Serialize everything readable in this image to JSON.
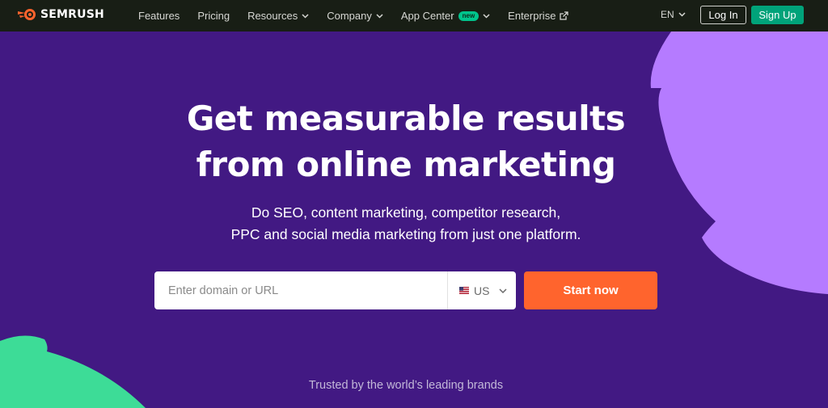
{
  "brand": {
    "name": "SEMRUSH",
    "logo_icon": "semrush-fire-icon"
  },
  "nav": {
    "items": [
      {
        "label": "Features",
        "dropdown": false
      },
      {
        "label": "Pricing",
        "dropdown": false
      },
      {
        "label": "Resources",
        "dropdown": true
      },
      {
        "label": "Company",
        "dropdown": true
      },
      {
        "label": "App Center",
        "dropdown": true,
        "badge": "new"
      },
      {
        "label": "Enterprise",
        "external": true
      }
    ],
    "language": "EN",
    "login_label": "Log In",
    "signup_label": "Sign Up"
  },
  "hero": {
    "headline_line1": "Get measurable results",
    "headline_line2": "from online marketing",
    "subhead_line1": "Do SEO, content marketing, competitor research,",
    "subhead_line2": "PPC and social media marketing from just one platform.",
    "search_placeholder": "Enter domain or URL",
    "search_value": "",
    "country": "US",
    "start_label": "Start now",
    "trusted_text": "Trusted by the world’s leading brands"
  },
  "colors": {
    "topbar_bg": "#181e15",
    "hero_bg": "#421983",
    "accent_orange": "#ff642d",
    "signup_green": "#00a37a",
    "blob_purple": "#b57bff",
    "blob_green": "#3ddc97"
  }
}
